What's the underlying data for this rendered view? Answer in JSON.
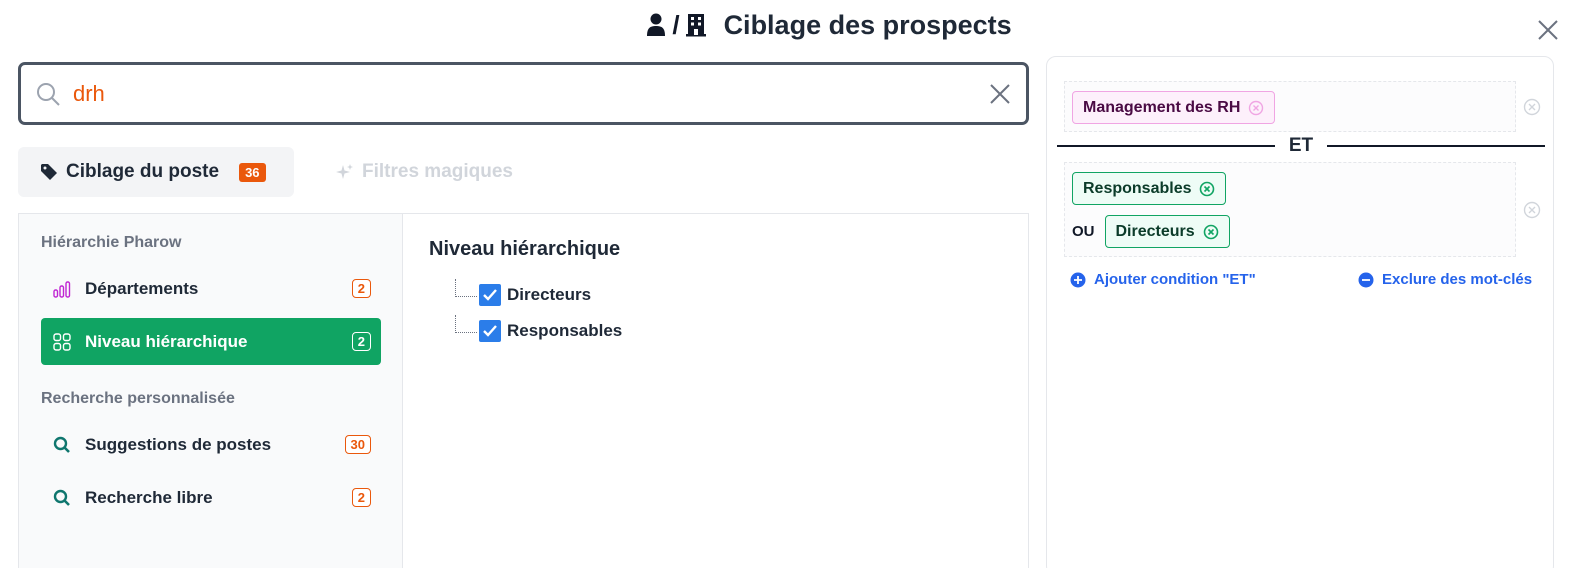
{
  "header": {
    "separator": "/",
    "title": "Ciblage des prospects"
  },
  "search": {
    "value": "drh",
    "placeholder": ""
  },
  "tabs": [
    {
      "label": "Ciblage du poste",
      "badge": "36"
    },
    {
      "label": "Filtres magiques"
    }
  ],
  "sidebar": {
    "section1": "Hiérarchie Pharow",
    "section2": "Recherche personnalisée",
    "items": [
      {
        "label": "Départements",
        "count": "2",
        "icon": "bar-chart-icon"
      },
      {
        "label": "Niveau hiérarchique",
        "count": "2",
        "icon": "grid-icon"
      },
      {
        "label": "Suggestions de postes",
        "count": "30",
        "icon": "search-icon"
      },
      {
        "label": "Recherche libre",
        "count": "2",
        "icon": "search-icon"
      }
    ]
  },
  "content": {
    "title": "Niveau hiérarchique",
    "options": [
      {
        "label": "Directeurs",
        "checked": true
      },
      {
        "label": "Responsables",
        "checked": true
      }
    ]
  },
  "rightpanel": {
    "group1": {
      "chips": [
        "Management des RH"
      ]
    },
    "and_label": "ET",
    "group2": {
      "chips": [
        "Responsables",
        "Directeurs"
      ],
      "or_label": "OU"
    },
    "add_condition": "Ajouter condition \"ET\"",
    "exclude_keywords": "Exclure des mot-clés"
  },
  "colors": {
    "accent_green": "#10a463",
    "accent_orange": "#ea580c",
    "link_blue": "#2563eb",
    "chip_pink": "#f0a5e3"
  }
}
